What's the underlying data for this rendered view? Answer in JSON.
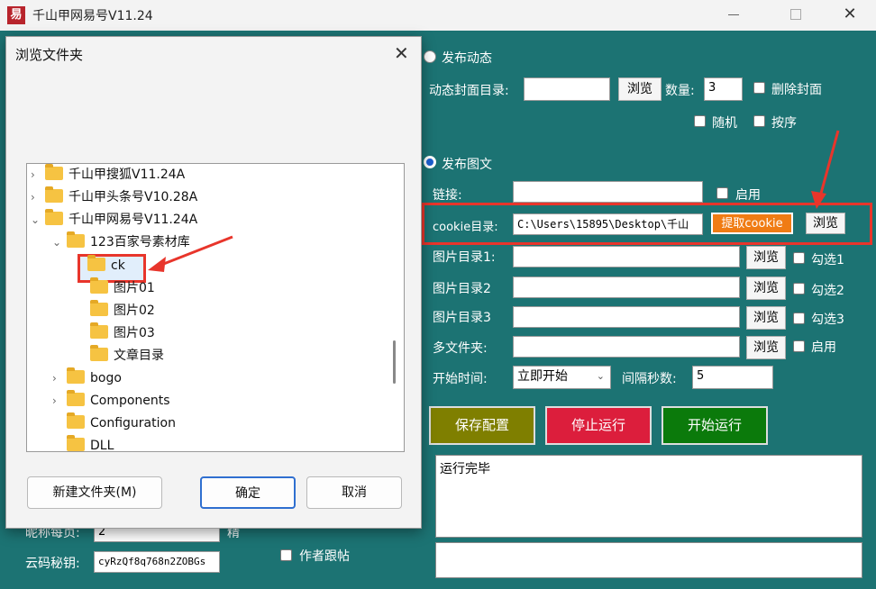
{
  "window": {
    "app_icon": "易",
    "title": "千山甲网易号V11.24",
    "close": "✕"
  },
  "post_dynamic": {
    "radio_label": "发布动态",
    "cover_dir_label": "动态封面目录:",
    "cover_dir_value": "",
    "browse": "浏览",
    "count_label": "数量:",
    "count_value": "3",
    "delete_cover": "删除封面",
    "random": "随机",
    "ordered": "按序"
  },
  "post_image": {
    "radio_label": "发布图文",
    "link_label": "链接:",
    "link_value": "",
    "enable": "启用",
    "cookie_label": "cookie目录:",
    "cookie_value": "C:\\Users\\15895\\Desktop\\千山",
    "extract_cookie": "提取cookie",
    "browse": "浏览",
    "image_dirs": [
      {
        "label": "图片目录1:",
        "value": "",
        "browse": "浏览",
        "check": "勾选1"
      },
      {
        "label": "图片目录2",
        "value": "",
        "browse": "浏览",
        "check": "勾选2"
      },
      {
        "label": "图片目录3",
        "value": "",
        "browse": "浏览",
        "check": "勾选3"
      }
    ],
    "multi_folder_label": "多文件夹:",
    "multi_folder_browse": "浏览",
    "multi_folder_enable": "启用",
    "start_time_label": "开始时间:",
    "start_time_value": "立即开始",
    "interval_label": "间隔秒数:",
    "interval_value": "5"
  },
  "actions": {
    "save": "保存配置",
    "stop": "停止运行",
    "start": "开始运行"
  },
  "log": {
    "text": "运行完毕"
  },
  "bottom_left": {
    "partial_label": "昵称每页:",
    "partial_value": "2",
    "partial_suffix": "精",
    "cloud_key_label": "云码秘钥:",
    "cloud_key_value": "cyRzQf8q768n2ZOBGs",
    "author_follow": "作者跟帖"
  },
  "dialog": {
    "title": "浏览文件夹",
    "close": "✕",
    "tree": [
      {
        "label": "千山甲搜狐V11.24A",
        "level": 0,
        "expander": "›"
      },
      {
        "label": "千山甲头条号V10.28A",
        "level": 0,
        "expander": "›"
      },
      {
        "label": "千山甲网易号V11.24A",
        "level": 0,
        "expander": "⌄"
      },
      {
        "label": "123百家号素材库",
        "level": 1,
        "expander": "⌄"
      },
      {
        "label": "ck",
        "level": 2,
        "expander": "",
        "selected": true
      },
      {
        "label": "图片01",
        "level": 2,
        "expander": ""
      },
      {
        "label": "图片02",
        "level": 2,
        "expander": ""
      },
      {
        "label": "图片03",
        "level": 2,
        "expander": ""
      },
      {
        "label": "文章目录",
        "level": 2,
        "expander": ""
      },
      {
        "label": "bogo",
        "level": 1,
        "expander": "›"
      },
      {
        "label": "Components",
        "level": 1,
        "expander": "›"
      },
      {
        "label": "Configuration",
        "level": 1,
        "expander": ""
      },
      {
        "label": "DLL",
        "level": 1,
        "expander": ""
      }
    ],
    "new_folder": "新建文件夹(M)",
    "ok": "确定",
    "cancel": "取消"
  },
  "colors": {
    "background": "#1c7373",
    "annotation": "#e8352b",
    "save": "#7f7f00",
    "stop": "#dc1e3c",
    "start": "#0b7a0b",
    "extract": "#f07c14"
  }
}
